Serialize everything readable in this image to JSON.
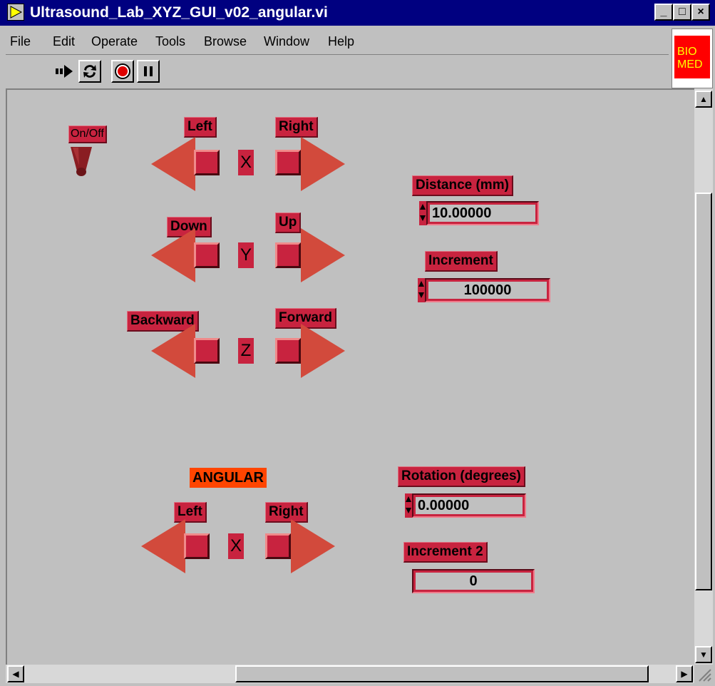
{
  "window": {
    "title": "Ultrasound_Lab_XYZ_GUI_v02_angular.vi",
    "minimize": "_",
    "maximize": "□",
    "close": "×"
  },
  "menu": [
    "File",
    "Edit",
    "Operate",
    "Tools",
    "Browse",
    "Window",
    "Help"
  ],
  "toolbar": {
    "run_icon": "run-arrow-icon",
    "continuous_icon": "continuous-run-icon",
    "abort_icon": "abort-icon",
    "pause_icon": "pause-icon"
  },
  "logo": {
    "line1": "BIO",
    "line2": "MED"
  },
  "onoff": {
    "label": "On/Off"
  },
  "axes": [
    {
      "axis": "X",
      "left_label": "Left",
      "right_label": "Right"
    },
    {
      "axis": "Y",
      "left_label": "Down",
      "right_label": "Up"
    },
    {
      "axis": "Z",
      "left_label": "Backward",
      "right_label": "Forward"
    }
  ],
  "distance": {
    "label": "Distance (mm)",
    "value": "10.00000"
  },
  "increment": {
    "label": "Increment",
    "value": "100000"
  },
  "angular": {
    "title": "ANGULAR",
    "axis": "X",
    "left_label": "Left",
    "right_label": "Right"
  },
  "rotation": {
    "label": "Rotation (degrees)",
    "value": "0.00000"
  },
  "increment2": {
    "label": "Increment 2",
    "value": "0"
  },
  "colors": {
    "control_red": "#c8233f",
    "arrow": "#d24a3c",
    "angular_label": "#ff4500",
    "title_bar": "#000080"
  }
}
